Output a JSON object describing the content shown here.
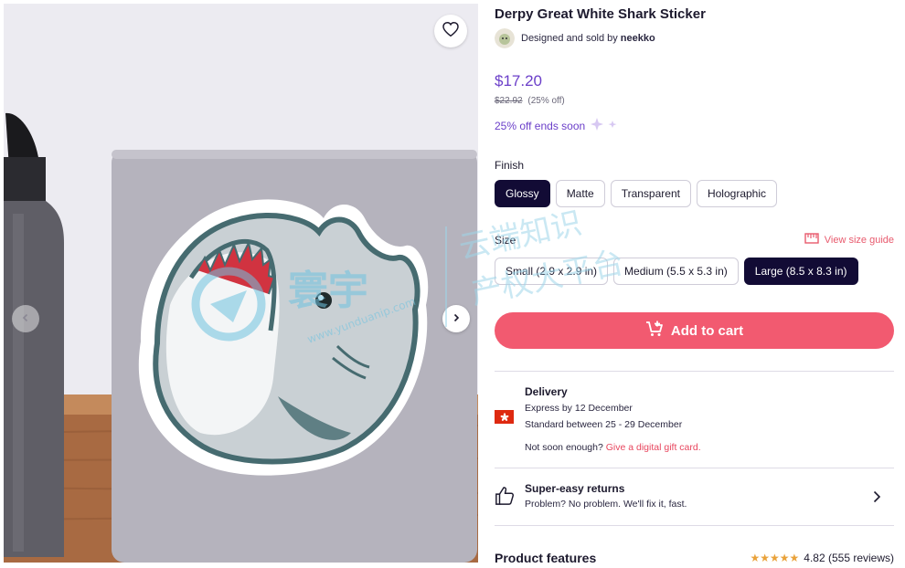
{
  "product": {
    "title": "Derpy Great White Shark Sticker",
    "designed_by_prefix": "Designed and sold by",
    "seller_name": "neekko"
  },
  "pricing": {
    "price": "$17.20",
    "original_price": "$22.92",
    "discount": "(25% off)",
    "promo": "25% off ends soon"
  },
  "finish": {
    "label": "Finish",
    "options": [
      "Glossy",
      "Matte",
      "Transparent",
      "Holographic"
    ],
    "selected": "Glossy"
  },
  "size": {
    "label": "Size",
    "guide_link": "View size guide",
    "options": [
      "Small (2.9 x 2.9 in)",
      "Medium (5.5 x 5.3 in)",
      "Large (8.5 x 8.3 in)"
    ],
    "selected": "Large (8.5 x 8.3 in)"
  },
  "cart": {
    "label": "Add to cart"
  },
  "delivery": {
    "title": "Delivery",
    "express": "Express by 12 December",
    "standard": "Standard between 25 - 29 December",
    "not_soon": "Not soon enough?",
    "gift_link": "Give a digital gift card."
  },
  "returns": {
    "title": "Super-easy returns",
    "subtitle": "Problem? No problem. We'll fix it, fast."
  },
  "features": {
    "title": "Product features"
  },
  "rating": {
    "score": "4.82",
    "reviews": "(555 reviews)",
    "stars": 5
  },
  "watermark": {
    "line1": "云端知识",
    "line2": "产权大平台",
    "url": "www.yunduanip.com"
  },
  "colors": {
    "accent_purple": "#6b3fc9",
    "cart_pink": "#f25a70",
    "selected_navy": "#120b35",
    "link_red": "#e8465e",
    "star_gold": "#e9a23b"
  }
}
